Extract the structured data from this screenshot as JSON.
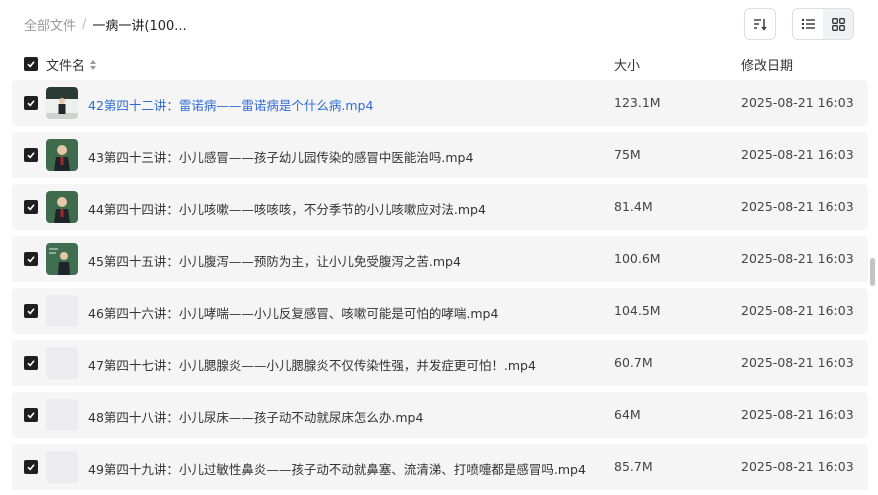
{
  "breadcrumb": {
    "root": "全部文件",
    "separator": "/",
    "current": "一病一讲(100..."
  },
  "columns": {
    "name": "文件名",
    "size": "大小",
    "date": "修改日期"
  },
  "files": [
    {
      "name": "42第四十二讲：雷诺病——雷诺病是个什么病.mp4",
      "size": "123.1M",
      "date": "2025-08-21 16:03",
      "thumb": "video-thumb-icon",
      "selected": true
    },
    {
      "name": "43第四十三讲：小儿感冒——孩子幼儿园传染的感冒中医能治吗.mp4",
      "size": "75M",
      "date": "2025-08-21 16:03",
      "thumb": "video-thumb-icon",
      "selected": true
    },
    {
      "name": "44第四十四讲：小儿咳嗽——咳咳咳，不分季节的小儿咳嗽应对法.mp4",
      "size": "81.4M",
      "date": "2025-08-21 16:03",
      "thumb": "video-thumb-icon",
      "selected": true
    },
    {
      "name": "45第四十五讲：小儿腹泻——预防为主，让小儿免受腹泻之苦.mp4",
      "size": "100.6M",
      "date": "2025-08-21 16:03",
      "thumb": "video-thumb-icon",
      "selected": true
    },
    {
      "name": "46第四十六讲：小儿哮喘——小儿反复感冒、咳嗽可能是可怕的哮喘.mp4",
      "size": "104.5M",
      "date": "2025-08-21 16:03",
      "thumb": "placeholder",
      "selected": true
    },
    {
      "name": "47第四十七讲：小儿腮腺炎——小儿腮腺炎不仅传染性强，并发症更可怕！.mp4",
      "size": "60.7M",
      "date": "2025-08-21 16:03",
      "thumb": "placeholder",
      "selected": true
    },
    {
      "name": "48第四十八讲：小儿尿床——孩子动不动就尿床怎么办.mp4",
      "size": "64M",
      "date": "2025-08-21 16:03",
      "thumb": "placeholder",
      "selected": true
    },
    {
      "name": "49第四十九讲：小儿过敏性鼻炎——孩子动不动就鼻塞、流清涕、打喷嚏都是感冒吗.mp4",
      "size": "85.7M",
      "date": "2025-08-21 16:03",
      "thumb": "placeholder",
      "selected": true
    }
  ],
  "colors": {
    "link": "#2f6bd6",
    "row_bg": "#f5f5f6",
    "checkbox": "#1f1f1f"
  }
}
